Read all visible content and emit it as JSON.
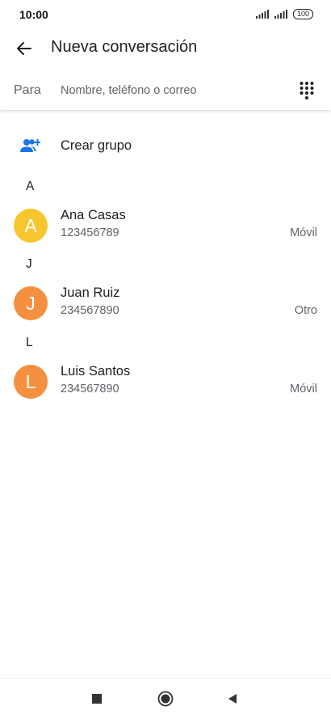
{
  "status_bar": {
    "time": "10:00",
    "battery": "100",
    "icons": [
      "signal-icon",
      "signal-icon",
      "battery-icon"
    ]
  },
  "app_bar": {
    "title": "Nueva conversación",
    "back_icon": "arrow-back-icon"
  },
  "to_field": {
    "label": "Para",
    "placeholder": "Nombre, teléfono o correo",
    "value": "",
    "dialpad_icon": "dialpad-icon"
  },
  "create_group": {
    "label": "Crear grupo",
    "icon": "group-add-icon",
    "color": "#1a73e8"
  },
  "sections": [
    {
      "letter": "A",
      "contacts": [
        {
          "initial": "A",
          "name": "Ana Casas",
          "phone": "123456789",
          "type": "Móvil",
          "color": "#f7c52d"
        }
      ]
    },
    {
      "letter": "J",
      "contacts": [
        {
          "initial": "J",
          "name": "Juan Ruiz",
          "phone": "234567890",
          "type": "Otro",
          "color": "#f4903f"
        }
      ]
    },
    {
      "letter": "L",
      "contacts": [
        {
          "initial": "L",
          "name": "Luis Santos",
          "phone": "234567890",
          "type": "Móvil",
          "color": "#f4903f"
        }
      ]
    }
  ],
  "nav_bar": {
    "icons": [
      "recents-square-icon",
      "home-circle-icon",
      "back-triangle-icon"
    ]
  }
}
